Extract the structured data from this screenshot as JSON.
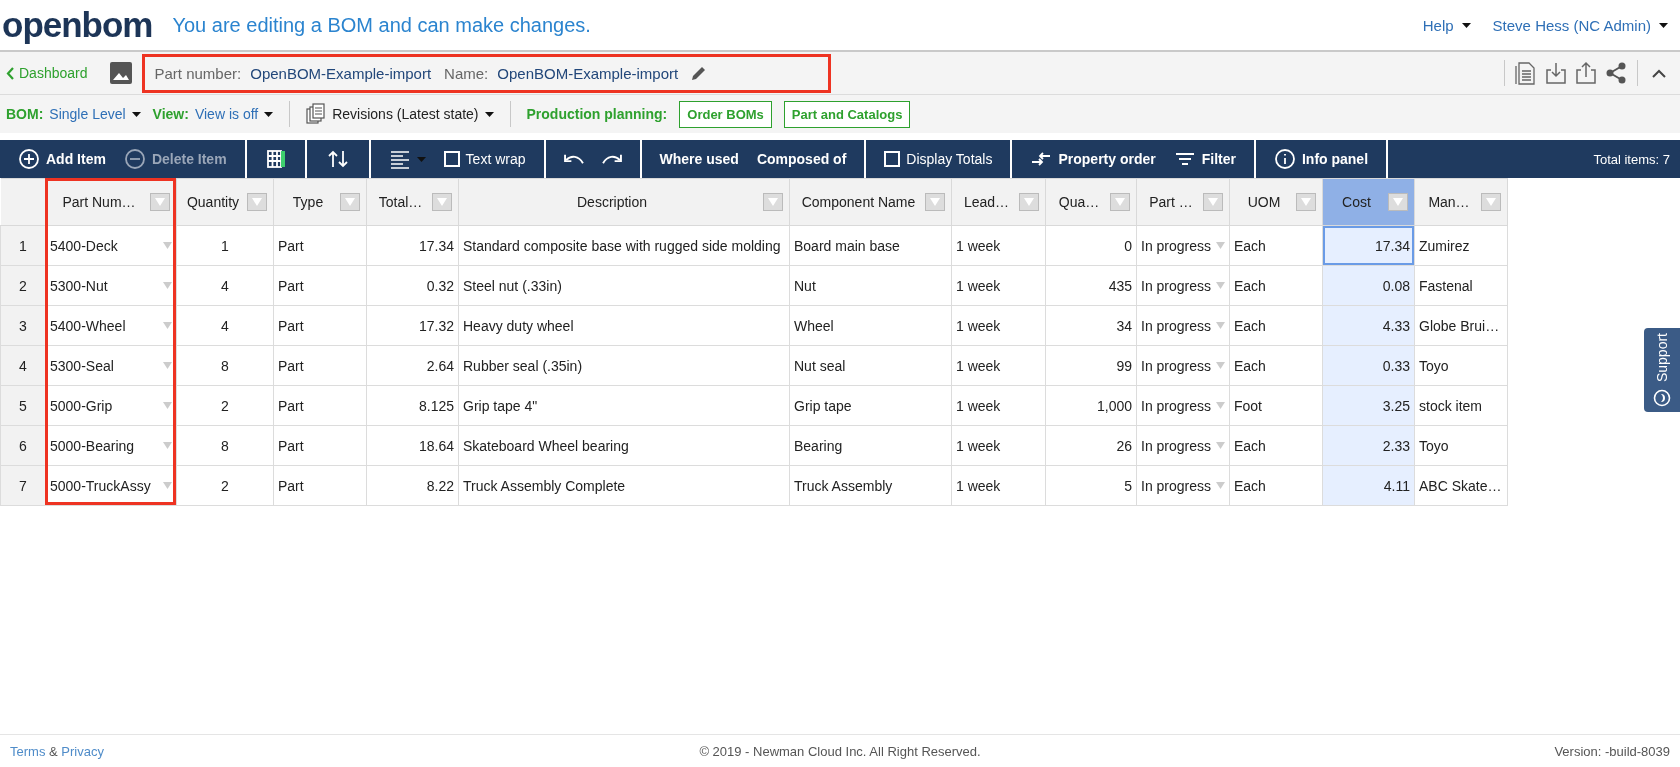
{
  "header": {
    "logo": "openbom",
    "message": "You are editing a BOM and can make changes.",
    "menus": [
      {
        "label": "Help"
      },
      {
        "label": "Steve Hess (NC Admin)"
      }
    ]
  },
  "bom_bar": {
    "back_link": "Dashboard",
    "highlighted": true,
    "part_number_label": "Part number:",
    "part_number": "OpenBOM-Example-import",
    "name_label": "Name:",
    "name": "OpenBOM-Example-import"
  },
  "options_bar": {
    "bom_label": "BOM:",
    "bom_value": "Single Level",
    "view_label": "View:",
    "view_value": "View is off",
    "revisions": "Revisions (Latest state)",
    "planning_label": "Production planning:",
    "planning_buttons": [
      "Order BOMs",
      "Part and Catalogs"
    ]
  },
  "toolbar": {
    "groups": [
      [
        {
          "kind": "add",
          "label": "Add Item",
          "disabled": false
        },
        {
          "kind": "delete",
          "label": "Delete Item",
          "disabled": true
        }
      ],
      [
        {
          "kind": "grid",
          "disabled": false
        }
      ],
      [
        {
          "kind": "sort",
          "disabled": false
        }
      ],
      [
        {
          "kind": "align",
          "disabled": false
        },
        {
          "kind": "checkbox",
          "label": "Text wrap",
          "checked": false,
          "disabled": false
        }
      ],
      [
        {
          "kind": "undo",
          "disabled": false
        },
        {
          "kind": "redo",
          "disabled": false
        }
      ],
      [
        {
          "kind": "text",
          "label": "Where used",
          "disabled": false
        },
        {
          "kind": "text",
          "label": "Composed of",
          "disabled": false
        }
      ],
      [
        {
          "kind": "checkbox",
          "label": "Display Totals",
          "checked": false,
          "disabled": false
        }
      ],
      [
        {
          "kind": "reorder",
          "label": "Property order",
          "disabled": false
        },
        {
          "kind": "filter",
          "label": "Filter",
          "disabled": false
        }
      ],
      [
        {
          "kind": "info",
          "label": "Info panel",
          "disabled": false
        }
      ]
    ],
    "total": "Total items: 7"
  },
  "table": {
    "columns": [
      {
        "label": "Part Num…",
        "kind": "select",
        "selected": false,
        "highlighted": true
      },
      {
        "label": "Quantity",
        "kind": "text",
        "selected": false,
        "highlighted": false
      },
      {
        "label": "Type",
        "kind": "text",
        "selected": false,
        "highlighted": false
      },
      {
        "label": "Total…",
        "kind": "text",
        "selected": false,
        "highlighted": false
      },
      {
        "label": "Description",
        "kind": "text",
        "selected": false,
        "highlighted": false
      },
      {
        "label": "Component Name",
        "kind": "text",
        "selected": false,
        "highlighted": false
      },
      {
        "label": "Lead…",
        "kind": "text",
        "selected": false,
        "highlighted": false
      },
      {
        "label": "Qua…",
        "kind": "text",
        "selected": false,
        "highlighted": false
      },
      {
        "label": "Part …",
        "kind": "select",
        "selected": false,
        "highlighted": false
      },
      {
        "label": "UOM",
        "kind": "text",
        "selected": false,
        "highlighted": false
      },
      {
        "label": "Cost",
        "kind": "text",
        "selected": true,
        "highlighted": false
      },
      {
        "label": "Man…",
        "kind": "text",
        "selected": false,
        "highlighted": false
      }
    ],
    "rows": [
      {
        "number": "1",
        "selected": true,
        "cells": [
          "5400-Deck",
          "1",
          "Part",
          "17.34",
          "Standard composite base with rugged side molding",
          "Board main base",
          "1 week",
          "0",
          "In progress",
          "Each",
          "17.34",
          "Zumirez"
        ]
      },
      {
        "number": "2",
        "selected": false,
        "cells": [
          "5300-Nut",
          "4",
          "Part",
          "0.32",
          "Steel nut (.33in)",
          "Nut",
          "1 week",
          "435",
          "In progress",
          "Each",
          "0.08",
          "Fastenal"
        ]
      },
      {
        "number": "3",
        "selected": false,
        "cells": [
          "5400-Wheel",
          "4",
          "Part",
          "17.32",
          "Heavy duty wheel",
          "Wheel",
          "1 week",
          "34",
          "In progress",
          "Each",
          "4.33",
          "Globe Brui…"
        ]
      },
      {
        "number": "4",
        "selected": false,
        "cells": [
          "5300-Seal",
          "8",
          "Part",
          "2.64",
          "Rubber seal (.35in)",
          "Nut seal",
          "1 week",
          "99",
          "In progress",
          "Each",
          "0.33",
          "Toyo"
        ]
      },
      {
        "number": "5",
        "selected": false,
        "cells": [
          "5000-Grip",
          "2",
          "Part",
          "8.125",
          "Grip tape 4\"",
          "Grip tape",
          "1 week",
          "1,000",
          "In progress",
          "Foot",
          "3.25",
          "stock item"
        ]
      },
      {
        "number": "6",
        "selected": false,
        "cells": [
          "5000-Bearing",
          "8",
          "Part",
          "18.64",
          "Skateboard Wheel bearing",
          "Bearing",
          "1 week",
          "26",
          "In progress",
          "Each",
          "2.33",
          "Toyo"
        ]
      },
      {
        "number": "7",
        "selected": false,
        "cells": [
          "5000-TruckAssy",
          "2",
          "Part",
          "8.22",
          "Truck Assembly Complete",
          "Truck Assembly",
          "1 week",
          "5",
          "In progress",
          "Each",
          "4.11",
          "ABC Skate…"
        ]
      }
    ]
  },
  "support_tab": "Support",
  "footer": {
    "terms": "Terms",
    "ampersand": "&",
    "privacy": "Privacy",
    "copyright": "© 2019 - Newman Cloud Inc. All Right Reserved.",
    "version": "Version: -build-8039"
  }
}
